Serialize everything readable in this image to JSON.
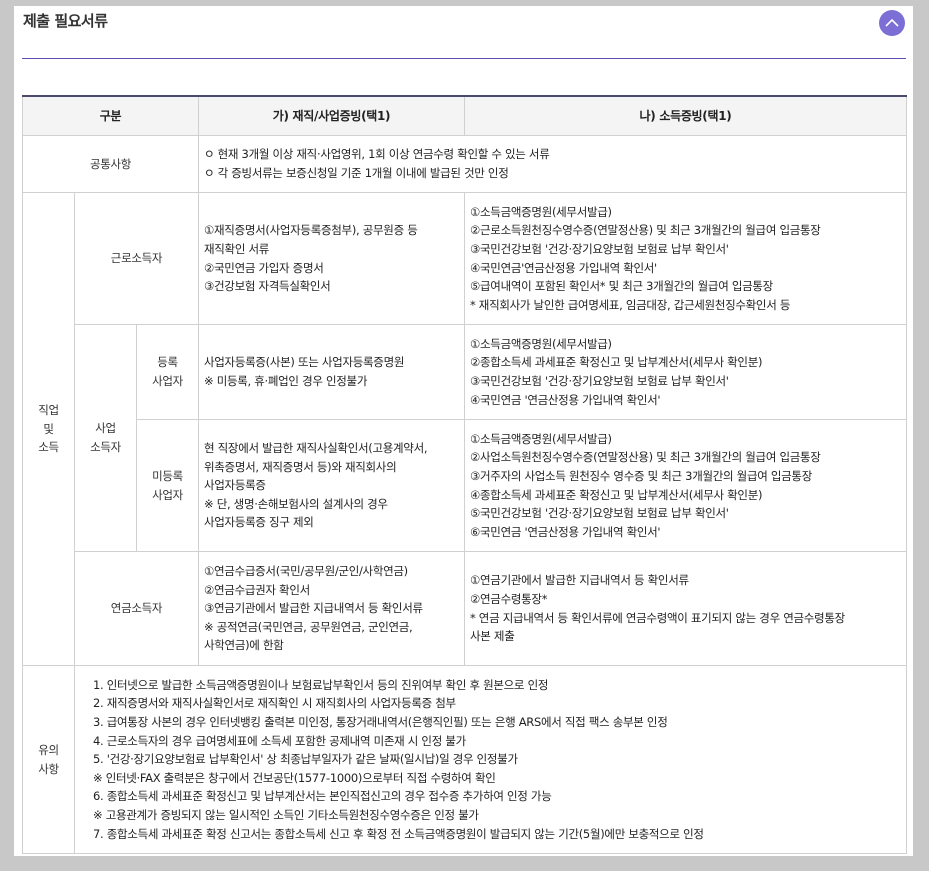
{
  "page": {
    "title": "제출 필요서류"
  },
  "table": {
    "headers": {
      "category": "구분",
      "col_a": "가) 재직/사업증빙(택1)",
      "col_b": "나) 소득증빙(택1)"
    },
    "common": {
      "label": "공통사항",
      "items": [
        "ㅇ 현재 3개월 이상 재직·사업영위, 1회 이상 연금수령 확인할 수 있는 서류",
        "ㅇ 각 증빙서류는 보증신청일 기준 1개월 이내에 발급된 것만 인정"
      ]
    },
    "job_income_label": "직업\n및\n소득",
    "labor": {
      "label": "근로소득자",
      "a": [
        "①재직증명서(사업자등록증첨부), 공무원증 등",
        "재직확인 서류",
        "②국민연금 가입자 증명서",
        "③건강보험 자격득실확인서"
      ],
      "b": [
        "①소득금액증명원(세무서발급)",
        "②근로소득원천징수영수증(연말정산용) 및 최근 3개월간의 월급여 입금통장",
        "③국민건강보험 '건강·장기요양보험 보험료 납부 확인서'",
        "④국민연금'연금산정용 가입내역 확인서'",
        "⑤급여내역이 포함된 확인서* 및 최근 3개월간의 월급여 입금통장",
        "* 재직회사가 날인한 급여명세표, 임금대장, 갑근세원천징수확인서 등"
      ]
    },
    "business_label": "사업\n소득자",
    "registered": {
      "label": "등록\n사업자",
      "a": [
        "사업자등록증(사본) 또는 사업자등록증명원",
        "※ 미등록, 휴·폐업인 경우 인정불가"
      ],
      "b": [
        "①소득금액증명원(세무서발급)",
        "②종합소득세 과세표준 확정신고 및 납부계산서(세무사 확인분)",
        "③국민건강보험 '건강·장기요양보험 보험료 납부 확인서'",
        "④국민연금 '연금산정용 가입내역 확인서'"
      ]
    },
    "unregistered": {
      "label": "미등록\n사업자",
      "a": [
        "현 직장에서 발급한 재직사실확인서(고용계약서,",
        "위촉증명서, 재직증명서 등)와 재직회사의",
        "사업자등록증",
        "※ 단, 생명·손해보험사의 설계사의 경우",
        "사업자등록증 징구 제외"
      ],
      "b": [
        "①소득금액증명원(세무서발급)",
        "②사업소득원천징수영수증(연말정산용) 및 최근 3개월간의 월급여 입금통장",
        "③거주자의 사업소득 원천징수 영수증 및 최근 3개월간의 월급여 입금통장",
        "④종합소득세 과세표준 확정신고 및 납부계산서(세무사 확인분)",
        "⑤국민건강보험 '건강·장기요양보험 보험료 납부 확인서'",
        "⑥국민연금 '연금산정용 가입내역 확인서'"
      ]
    },
    "pension": {
      "label": "연금소득자",
      "a": [
        "①연금수급증서(국민/공무원/군인/사학연금)",
        "②연금수급권자 확인서",
        "③연금기관에서 발급한 지급내역서 등 확인서류",
        "※ 공적연금(국민연금, 공무원연금, 군인연금,",
        "사학연금)에 한함"
      ],
      "b": [
        "①연금기관에서 발급한 지급내역서 등 확인서류",
        "②연금수령통장*",
        "* 연금 지급내역서 등 확인서류에 연금수령액이 표기되지 않는 경우 연금수령통장",
        "사본 제출"
      ]
    },
    "notes": {
      "label": "유의\n사항",
      "items": [
        "1. 인터넷으로 발급한 소득금액증명원이나 보험료납부확인서 등의 진위여부 확인 후 원본으로 인정",
        "2. 재직증명서와 재직사실확인서로 재직확인 시 재직회사의 사업자등록증 첨부",
        "3. 급여통장 사본의 경우 인터넷뱅킹 출력본 미인정, 통장거래내역서(은행직인필) 또는 은행 ARS에서 직접 팩스 송부본 인정",
        "4. 근로소득자의 경우 급여명세표에 소득세 포함한 공제내역 미존재 시 인정 불가",
        "5. '건강·장기요양보험료 납부확인서' 상 최종납부일자가 같은 날짜(일시납)일 경우 인정불가",
        "※ 인터넷·FAX 출력분은 창구에서 건보공단(1577-1000)으로부터 직접 수령하여 확인",
        "6. 종합소득세 과세표준 확정신고 및 납부계산서는 본인직접신고의 경우 접수증 추가하여 인정 가능",
        "※ 고용관계가 증빙되지 않는 일시적인 소득인 기타소득원천징수영수증은 인정 불가",
        "7. 종합소득세 과세표준 확정 신고서는 종합소득세 신고 후 확정 전 소득금액증명원이 발급되지 않는 기간(5월)에만 보충적으로 인정"
      ]
    }
  }
}
